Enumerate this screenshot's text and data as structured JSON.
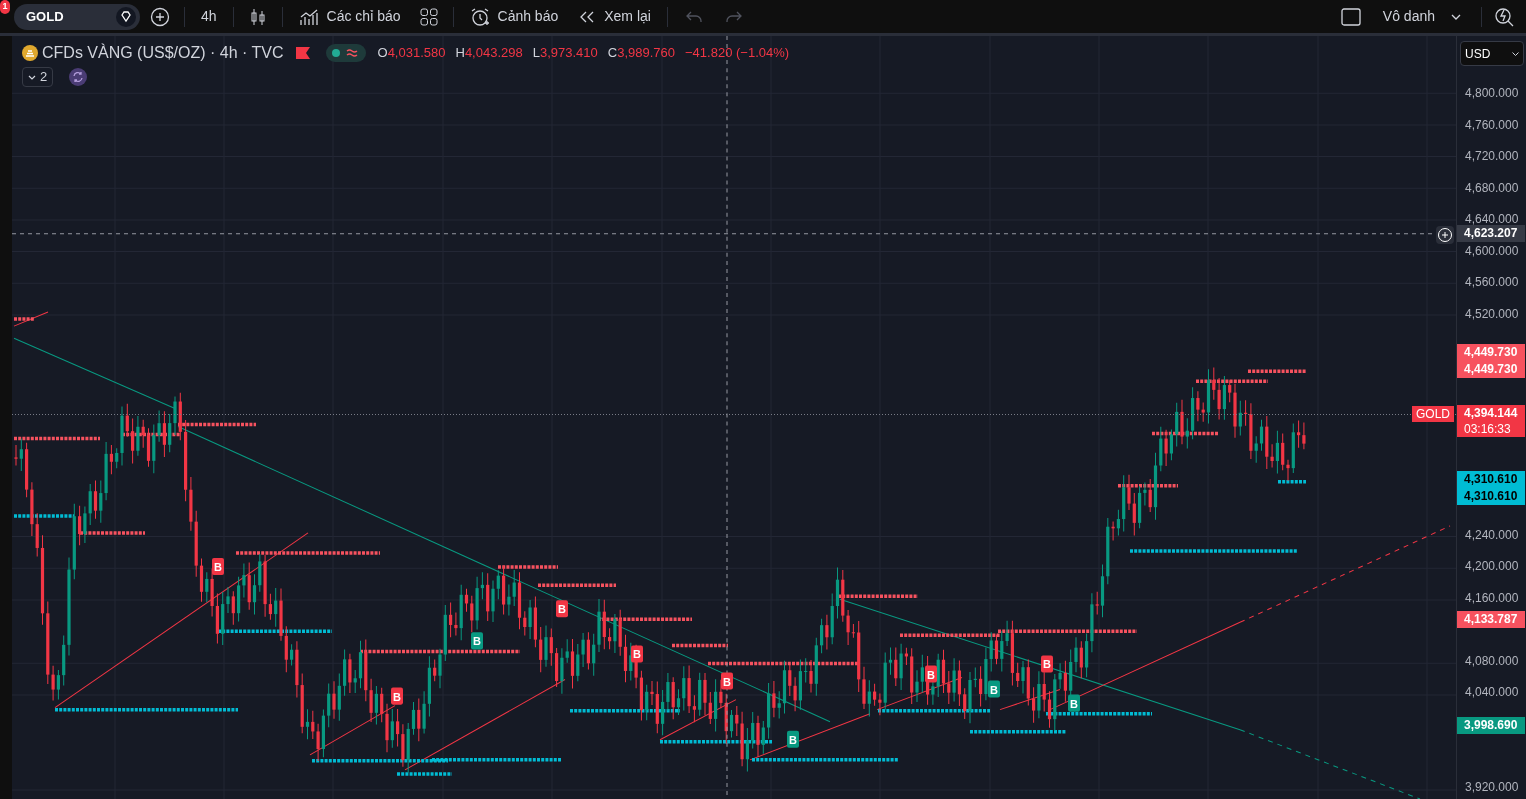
{
  "toolbar": {
    "notification_count": "1",
    "symbol": "GOLD",
    "interval": "4h",
    "indicators_label": "Các chỉ báo",
    "alerts_label": "Cảnh báo",
    "replay_label": "Xem lại",
    "undo_disabled": true,
    "redo_disabled": true,
    "layout_name": "Vô danh"
  },
  "legend": {
    "title": "CFDs VÀNG (US$/OZ) · 4h · TVC",
    "ohlc": [
      {
        "label": "O",
        "value": "4,031.580"
      },
      {
        "label": "H",
        "value": "4,043.298"
      },
      {
        "label": "L",
        "value": "3,973.410"
      },
      {
        "label": "C",
        "value": "3,989.760"
      }
    ],
    "change": "−41.820 (−1.04%)",
    "study_count": "2"
  },
  "currency": "USD",
  "price_axis": [
    "4,800.000",
    "4,760.000",
    "4,720.000",
    "4,680.000",
    "4,640.000",
    "4,600.000",
    "4,560.000",
    "4,520.000",
    "4,240.000",
    "4,200.000",
    "4,160.000",
    "4,080.000",
    "4,040.000",
    "3,920.000"
  ],
  "price_tags": [
    {
      "kind": "crosshair",
      "value": "4,623.207"
    },
    {
      "kind": "resistance",
      "value": "4,449.730"
    },
    {
      "kind": "resistance",
      "value": "4,449.730"
    },
    {
      "kind": "last",
      "symbol": "GOLD",
      "value": "4,394.144",
      "countdown": "03:16:33"
    },
    {
      "kind": "support",
      "value": "4,310.610"
    },
    {
      "kind": "support",
      "value": "4,310.610"
    },
    {
      "kind": "resistance",
      "value": "4,133.787"
    },
    {
      "kind": "signal",
      "value": "3,998.690"
    }
  ],
  "signals": [
    {
      "label": "B",
      "color": "#f23645"
    },
    {
      "label": "B",
      "color": "#f23645"
    },
    {
      "label": "B",
      "color": "#f23645"
    },
    {
      "label": "B",
      "color": "#f23645"
    },
    {
      "label": "B",
      "color": "#f23645"
    },
    {
      "label": "B",
      "color": "#f23645"
    },
    {
      "label": "B",
      "color": "#f23645"
    },
    {
      "label": "B",
      "color": "#089981"
    },
    {
      "label": "B",
      "color": "#089981"
    },
    {
      "label": "B",
      "color": "#089981"
    },
    {
      "label": "B",
      "color": "#089981"
    }
  ]
}
